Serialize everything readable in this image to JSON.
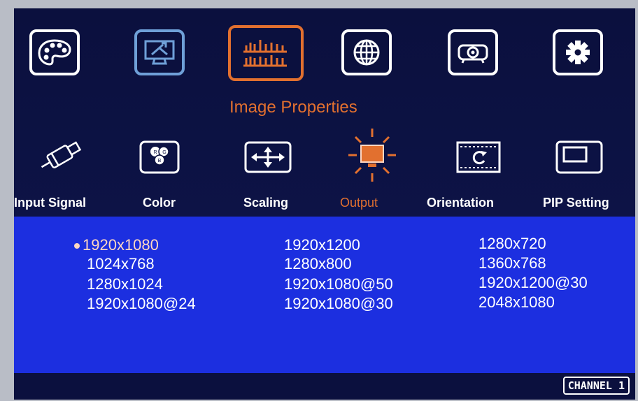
{
  "top_menu": {
    "items": [
      {
        "icon": "palette-icon"
      },
      {
        "icon": "monitor-tools-icon"
      },
      {
        "icon": "image-properties-icon"
      },
      {
        "icon": "globe-icon"
      },
      {
        "icon": "projector-icon"
      },
      {
        "icon": "gear-icon"
      }
    ],
    "selected_title": "Image Properties"
  },
  "sub_menu": {
    "items": [
      {
        "label": "Input Signal",
        "icon": "usb-cable-icon"
      },
      {
        "label": "Color",
        "icon": "rgb-circles-icon"
      },
      {
        "label": "Scaling",
        "icon": "scaling-arrows-icon"
      },
      {
        "label": "Output",
        "icon": "output-sun-monitor-icon"
      },
      {
        "label": "Orientation",
        "icon": "rotate-icon"
      },
      {
        "label": "PIP Setting",
        "icon": "pip-window-icon"
      }
    ],
    "active": "Output"
  },
  "resolutions": {
    "col1": [
      "1920x1080",
      "1024x768",
      "1280x1024",
      "1920x1080@24"
    ],
    "col2": [
      "1920x1200",
      "1280x800",
      "1920x1080@50",
      "1920x1080@30"
    ],
    "col3": [
      "1280x720",
      "1360x768",
      "1920x1200@30",
      "2048x1080"
    ],
    "selected": "1920x1080"
  },
  "status": {
    "channel": "CHANNEL 1"
  },
  "colors": {
    "accent": "#e2702f",
    "panel": "#1c2fe0",
    "background": "#0b103e"
  }
}
